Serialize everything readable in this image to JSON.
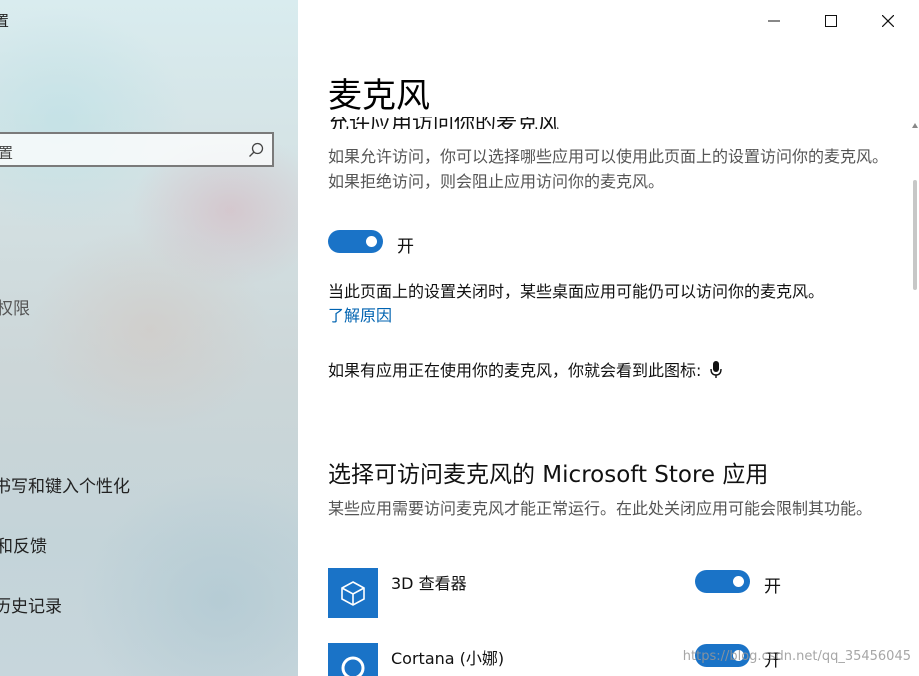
{
  "left_pane": {
    "title": "置",
    "search_value": "置",
    "nav_items": [
      {
        "label": "权限"
      },
      {
        "label": "书写和键入个性化"
      },
      {
        "label": "和反馈"
      },
      {
        "label": "历史记录"
      }
    ]
  },
  "window_controls": {
    "minimize": "minimize-icon",
    "maximize": "maximize-icon",
    "close": "close-icon"
  },
  "page": {
    "title": "麦克风",
    "partial_heading": "允许应用访问你的麦克风",
    "allow_description": "如果允许访问，你可以选择哪些应用可以使用此页面上的设置访问你的麦克风。如果拒绝访问，则会阻止应用访问你的麦克风。",
    "master_toggle": {
      "state_label": "开",
      "on": true
    },
    "desktop_note": "当此页面上的设置关闭时，某些桌面应用可能仍可以访问你的麦克风。",
    "learn_more": "了解原因",
    "icon_note": "如果有应用正在使用你的麦克风，你就会看到此图标:",
    "store_section": {
      "heading": "选择可访问麦克风的 Microsoft Store 应用",
      "description": "某些应用需要访问麦克风才能正常运行。在此处关闭应用可能会限制其功能。",
      "apps": [
        {
          "name": "3D 查看器",
          "icon": "cube-icon",
          "toggle_label": "开",
          "on": true
        },
        {
          "name": "Cortana (小娜)",
          "icon": "cortana-ring-icon",
          "toggle_label": "开",
          "on": true
        }
      ]
    }
  },
  "watermark": "https://blog.csdn.net/qq_35456045",
  "colors": {
    "accent": "#1a73c7",
    "link": "#0063b1"
  }
}
